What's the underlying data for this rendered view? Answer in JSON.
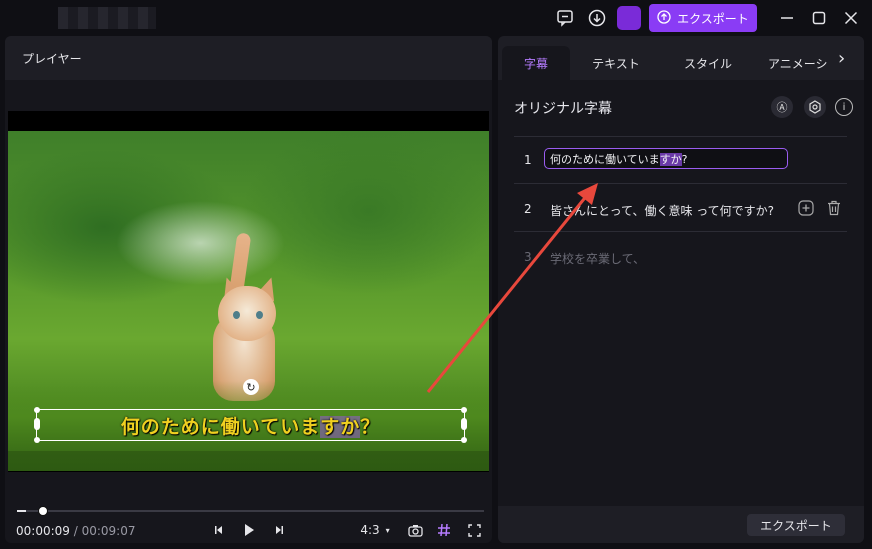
{
  "titlebar": {
    "export_label": "エクスポート"
  },
  "player": {
    "title": "プレイヤー",
    "subtitle_before": "何のために働いていま",
    "subtitle_selected": "すか",
    "subtitle_after": "？",
    "progress": 0.02,
    "current_time": "00:00:09",
    "separator": " / ",
    "total_time": "00:09:07",
    "aspect_ratio": "4:3"
  },
  "panel": {
    "tabs": [
      "字幕",
      "テキスト",
      "スタイル",
      "アニメーシ"
    ],
    "active_tab": "字幕",
    "section_title": "オリジナル字幕",
    "rows": [
      {
        "num": "1",
        "before": "何のために働いていま",
        "selected": "すか",
        "after": "?"
      },
      {
        "num": "2",
        "text": "皆さんにとって、働く意味 って何ですか?"
      },
      {
        "num": "3",
        "text": "学校を卒業して、"
      }
    ],
    "export_label": "エクスポート"
  },
  "colors": {
    "accent": "#8a3cf5",
    "subtitle": "#f0d020",
    "annotation_arrow": "#e8483c"
  }
}
